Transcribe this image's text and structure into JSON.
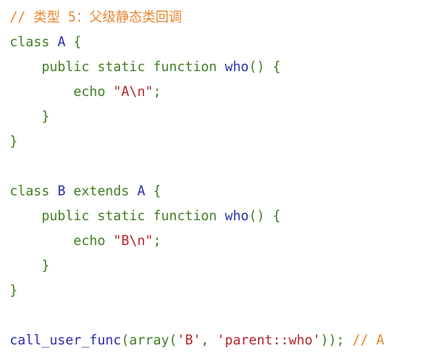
{
  "code": {
    "lines": [
      {
        "tokens": [
          {
            "t": "// 类型 5：父级静态类回调",
            "c": "comment"
          }
        ]
      },
      {
        "tokens": [
          {
            "t": "class ",
            "c": "plain"
          },
          {
            "t": "A",
            "c": "fn"
          },
          {
            "t": " {",
            "c": "plain"
          }
        ]
      },
      {
        "tokens": [
          {
            "t": "    public static function ",
            "c": "plain"
          },
          {
            "t": "who",
            "c": "fn"
          },
          {
            "t": "() {",
            "c": "plain"
          }
        ]
      },
      {
        "tokens": [
          {
            "t": "        echo ",
            "c": "plain"
          },
          {
            "t": "\"A\\n\"",
            "c": "str"
          },
          {
            "t": ";",
            "c": "plain"
          }
        ]
      },
      {
        "tokens": [
          {
            "t": "    }",
            "c": "plain"
          }
        ]
      },
      {
        "tokens": [
          {
            "t": "}",
            "c": "plain"
          }
        ]
      },
      {
        "tokens": []
      },
      {
        "tokens": [
          {
            "t": "class ",
            "c": "plain"
          },
          {
            "t": "B",
            "c": "fn"
          },
          {
            "t": " extends ",
            "c": "plain"
          },
          {
            "t": "A",
            "c": "fn"
          },
          {
            "t": " {",
            "c": "plain"
          }
        ]
      },
      {
        "tokens": [
          {
            "t": "    public static function ",
            "c": "plain"
          },
          {
            "t": "who",
            "c": "fn"
          },
          {
            "t": "() {",
            "c": "plain"
          }
        ]
      },
      {
        "tokens": [
          {
            "t": "        echo ",
            "c": "plain"
          },
          {
            "t": "\"B\\n\"",
            "c": "str"
          },
          {
            "t": ";",
            "c": "plain"
          }
        ]
      },
      {
        "tokens": [
          {
            "t": "    }",
            "c": "plain"
          }
        ]
      },
      {
        "tokens": [
          {
            "t": "}",
            "c": "plain"
          }
        ]
      },
      {
        "tokens": []
      },
      {
        "tokens": [
          {
            "t": "call_user_func",
            "c": "fn"
          },
          {
            "t": "(array(",
            "c": "plain"
          },
          {
            "t": "'B'",
            "c": "str"
          },
          {
            "t": ", ",
            "c": "plain"
          },
          {
            "t": "'parent::who'",
            "c": "str"
          },
          {
            "t": ")); ",
            "c": "plain"
          },
          {
            "t": "// A",
            "c": "comment"
          }
        ]
      }
    ]
  },
  "colors": {
    "plain": "#3f7f24",
    "fn": "#2a2fa8",
    "string": "#b3262d",
    "comment": "#e8872f",
    "background": "#ffffff"
  }
}
